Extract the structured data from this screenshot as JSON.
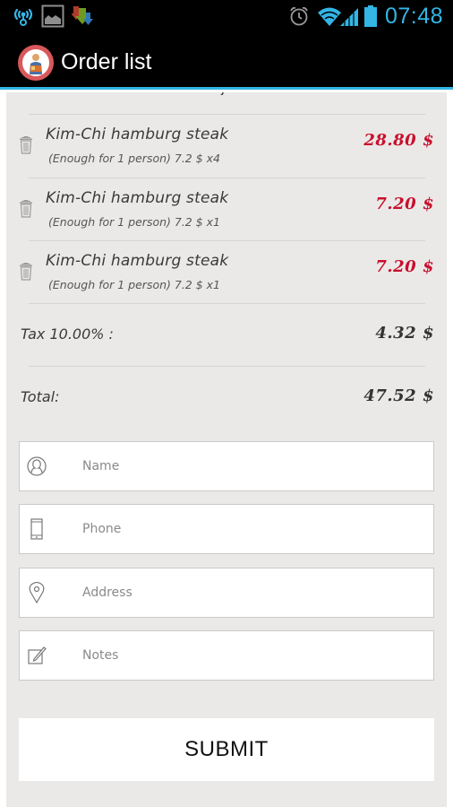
{
  "status_bar": {
    "time": "07:48",
    "icons": [
      "wireless-tether-icon",
      "image-notification-icon",
      "download-icon",
      "alarm-icon",
      "wifi-icon",
      "signal-icon",
      "battery-icon"
    ],
    "accent_color": "#33b5e5"
  },
  "action_bar": {
    "title": "Order list",
    "logo": "app-logo-icon"
  },
  "order": {
    "items": [
      {
        "name": "Kim-Chi hamburg steak",
        "detail": "(Enough for 1 person) 7.2 $ x4",
        "price": "28.80 $"
      },
      {
        "name": "Kim-Chi hamburg steak",
        "detail": "(Enough for 1 person) 7.2 $ x1",
        "price": "7.20 $"
      },
      {
        "name": "Kim-Chi hamburg steak",
        "detail": "(Enough for 1 person) 7.2 $ x1",
        "price": "7.20 $"
      }
    ],
    "tax_label": "Tax 10.00% :",
    "tax_value": "4.32 $",
    "total_label": "Total:",
    "total_value": "47.52 $",
    "price_color": "#c8102e"
  },
  "form": {
    "name_placeholder": "Name",
    "phone_placeholder": "Phone",
    "address_placeholder": "Address",
    "notes_placeholder": "Notes",
    "name_value": "",
    "phone_value": "",
    "address_value": "",
    "notes_value": "",
    "submit_label": "SUBMIT"
  }
}
